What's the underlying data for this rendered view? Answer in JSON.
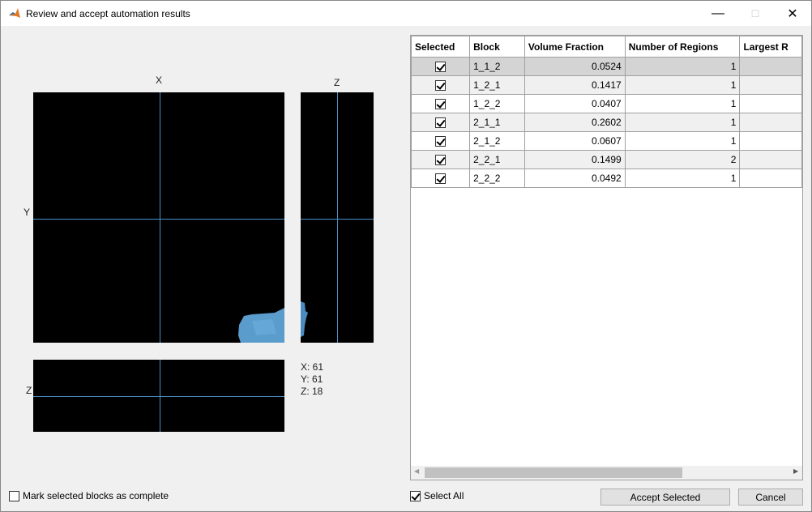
{
  "window": {
    "title": "Review and accept automation results",
    "minimize": "—",
    "maximize": "☐",
    "close": "✕"
  },
  "views": {
    "top_label": "X",
    "side_label": "Z",
    "y_label": "Y",
    "bottom_z_label": "Z"
  },
  "coords": {
    "x": "X: 61",
    "y": "Y: 61",
    "z": "Z: 18"
  },
  "table": {
    "columns": [
      "Selected",
      "Block",
      "Volume Fraction",
      "Number of Regions",
      "Largest R"
    ],
    "rows": [
      {
        "selected": true,
        "block": "1_1_2",
        "vf": "0.0524",
        "regions": "1"
      },
      {
        "selected": true,
        "block": "1_2_1",
        "vf": "0.1417",
        "regions": "1"
      },
      {
        "selected": true,
        "block": "1_2_2",
        "vf": "0.0407",
        "regions": "1"
      },
      {
        "selected": true,
        "block": "2_1_1",
        "vf": "0.2602",
        "regions": "1"
      },
      {
        "selected": true,
        "block": "2_1_2",
        "vf": "0.0607",
        "regions": "1"
      },
      {
        "selected": true,
        "block": "2_2_1",
        "vf": "0.1499",
        "regions": "2"
      },
      {
        "selected": true,
        "block": "2_2_2",
        "vf": "0.0492",
        "regions": "1"
      }
    ]
  },
  "footer": {
    "mark_complete": "Mark selected blocks as complete",
    "select_all": "Select All",
    "accept": "Accept Selected",
    "cancel": "Cancel"
  },
  "colors": {
    "crosshair": "#4a90c8",
    "mask": "#5a9ccc"
  }
}
